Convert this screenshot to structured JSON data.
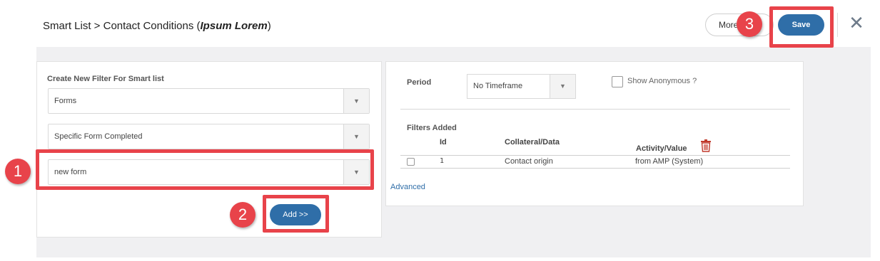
{
  "header": {
    "title_prefix": "Smart List > Contact Conditions (",
    "title_name": "Ipsum Lorem",
    "title_suffix": ")",
    "more_label": "More",
    "save_label": "Save",
    "close_icon": "close-icon"
  },
  "left_panel": {
    "label": "Create New Filter For Smart list",
    "select_type": "Forms",
    "select_condition": "Specific Form Completed",
    "select_form": "new form",
    "add_label": "Add >>"
  },
  "right_panel": {
    "period_label": "Period",
    "period_value": "No Timeframe",
    "show_anonymous_label": "Show Anonymous ?",
    "filters_added_label": "Filters Added",
    "columns": [
      "Id",
      "Collateral/Data",
      "Activity/Value"
    ],
    "rows": [
      {
        "id": "1",
        "collateral": "Contact origin",
        "activity": "from AMP (System)"
      }
    ],
    "advanced_label": "Advanced"
  },
  "annotations": {
    "badge_1": "1",
    "badge_2": "2",
    "badge_3": "3",
    "color": "#e8434a"
  }
}
